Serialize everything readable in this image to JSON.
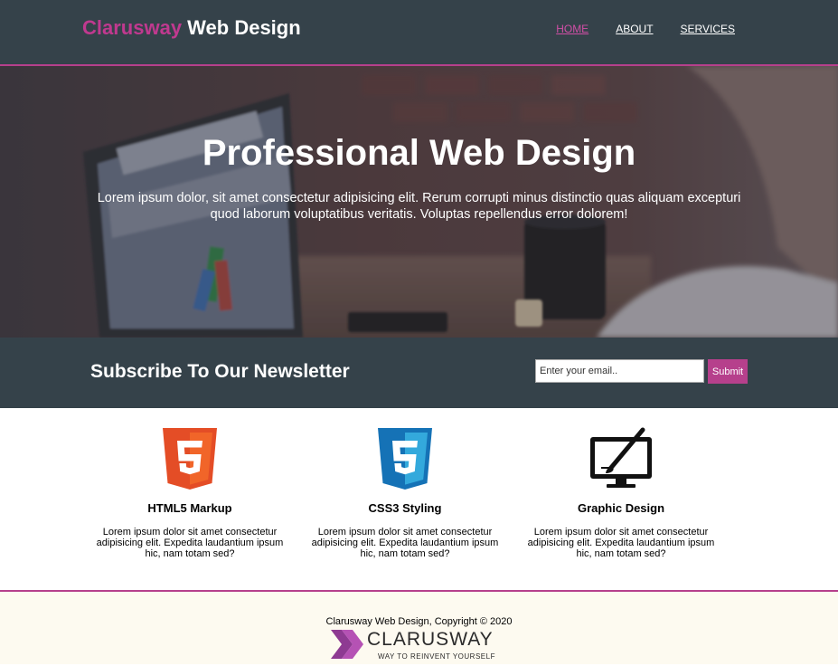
{
  "header": {
    "logo_accent": "Clarusway",
    "logo_rest": " Web Design",
    "nav": [
      {
        "label": "HOME",
        "active": true
      },
      {
        "label": "ABOUT",
        "active": false
      },
      {
        "label": "SERVICES",
        "active": false
      }
    ]
  },
  "hero": {
    "title": "Professional Web Design",
    "text": "Lorem ipsum dolor, sit amet consectetur adipisicing elit. Rerum corrupti minus distinctio quas aliquam excepturi quod laborum voluptatibus veritatis. Voluptas repellendus error dolorem!"
  },
  "newsletter": {
    "heading": "Subscribe To Our Newsletter",
    "email_placeholder": "Enter your email..",
    "email_value": "",
    "submit_label": "Submit"
  },
  "boxes": [
    {
      "icon": "html5-icon",
      "title": "HTML5 Markup",
      "text": "Lorem ipsum dolor sit amet consectetur adipisicing elit. Expedita laudantium ipsum hic, nam totam sed?"
    },
    {
      "icon": "css3-icon",
      "title": "CSS3 Styling",
      "text": "Lorem ipsum dolor sit amet consectetur adipisicing elit. Expedita laudantium ipsum hic, nam totam sed?"
    },
    {
      "icon": "graphic-design-icon",
      "title": "Graphic Design",
      "text": "Lorem ipsum dolor sit amet consectetur adipisicing elit. Expedita laudantium ipsum hic, nam totam sed?"
    }
  ],
  "footer": {
    "copyright": "Clarusway Web Design, Copyright © 2020",
    "brand_name": "CLARUSWAY",
    "brand_tagline": "WAY TO REINVENT YOURSELF"
  },
  "colors": {
    "header_bg": "#35424a",
    "accent": "#b6408c",
    "footer_bg": "#fdfaf0"
  }
}
